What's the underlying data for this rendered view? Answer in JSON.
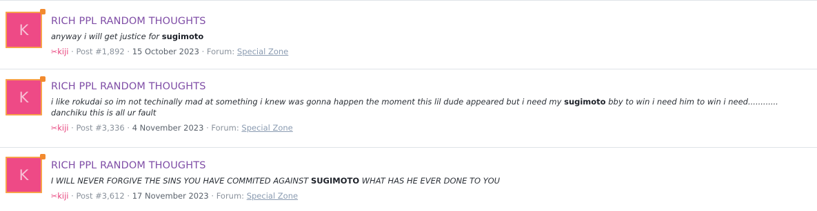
{
  "results": [
    {
      "avatar_letter": "K",
      "title": "RICH PPL RANDOM THOUGHTS",
      "snippet_before": "anyway i will get justice for ",
      "snippet_highlight": "sugimoto",
      "snippet_after": "",
      "author_mark": "✂",
      "author": "kiji",
      "post_label": "Post #1,892",
      "date": "15 October 2023",
      "forum_label": "Forum:",
      "forum": "Special Zone"
    },
    {
      "avatar_letter": "K",
      "title": "RICH PPL RANDOM THOUGHTS",
      "snippet_before": "i like rokudai so im not techinally mad at something i knew was gonna happen the moment this lil dude appeared but i need my ",
      "snippet_highlight": "sugimoto",
      "snippet_after": " bby to win i need him to win i need............ danchiku this is all ur fault",
      "author_mark": "✂",
      "author": "kiji",
      "post_label": "Post #3,336",
      "date": "4 November 2023",
      "forum_label": "Forum:",
      "forum": "Special Zone"
    },
    {
      "avatar_letter": "K",
      "title": "RICH PPL RANDOM THOUGHTS",
      "snippet_before": "I WILL NEVER FORGIVE THE SINS YOU HAVE COMMITED AGAINST ",
      "snippet_highlight": "SUGIMOTO",
      "snippet_after": " WHAT HAS HE EVER DONE TO YOU",
      "author_mark": "✂",
      "author": "kiji",
      "post_label": "Post #3,612",
      "date": "17 November 2023",
      "forum_label": "Forum:",
      "forum": "Special Zone"
    }
  ],
  "separator": "·",
  "colors": {
    "title": "#7f4da6",
    "author": "#e8447d",
    "avatar_bg": "#ee4a86",
    "avatar_border": "#f7a24a"
  }
}
